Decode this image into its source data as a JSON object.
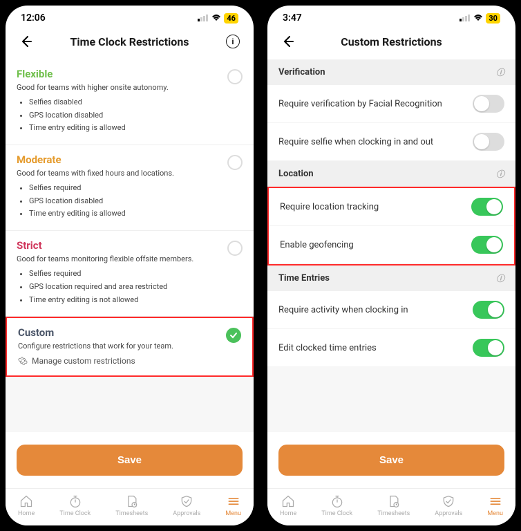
{
  "left": {
    "status": {
      "time": "12:06",
      "battery": "46"
    },
    "header": {
      "title": "Time Clock Restrictions"
    },
    "options": {
      "flexible": {
        "title": "Flexible",
        "desc": "Good for teams with higher onsite autonomy.",
        "b1": "Selfies disabled",
        "b2": "GPS location disabled",
        "b3": "Time entry editing is allowed"
      },
      "moderate": {
        "title": "Moderate",
        "desc": "Good for teams with fixed hours and locations.",
        "b1": "Selfies required",
        "b2": "GPS location disabled",
        "b3": "Time entry editing is allowed"
      },
      "strict": {
        "title": "Strict",
        "desc": "Good for teams monitoring flexible offsite members.",
        "b1": "Selfies required",
        "b2": "GPS location required and area restricted",
        "b3": "Time entry editing is not allowed"
      },
      "custom": {
        "title": "Custom",
        "desc": "Configure restrictions that work for your team.",
        "manage": "Manage custom restrictions"
      }
    },
    "save": "Save",
    "tabs": {
      "home": "Home",
      "timeclock": "Time Clock",
      "timesheets": "Timesheets",
      "approvals": "Approvals",
      "menu": "Menu"
    }
  },
  "right": {
    "status": {
      "time": "3:47",
      "battery": "30"
    },
    "header": {
      "title": "Custom Restrictions"
    },
    "sections": {
      "verification": {
        "title": "Verification",
        "facial": "Require verification by Facial Recognition",
        "selfie": "Require selfie when clocking in and out"
      },
      "location": {
        "title": "Location",
        "tracking": "Require location tracking",
        "geofence": "Enable geofencing"
      },
      "time_entries": {
        "title": "Time Entries",
        "activity": "Require activity when clocking in",
        "edit": "Edit clocked time entries"
      }
    },
    "save": "Save",
    "tabs": {
      "home": "Home",
      "timeclock": "Time Clock",
      "timesheets": "Timesheets",
      "approvals": "Approvals",
      "menu": "Menu"
    }
  }
}
